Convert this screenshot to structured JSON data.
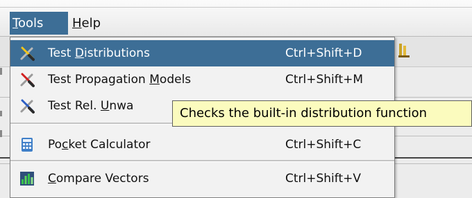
{
  "menubar": {
    "menus": [
      {
        "label": "Tools",
        "mnemonic": "T",
        "rest": "ools"
      },
      {
        "label": "Help",
        "mnemonic": "H",
        "rest": "elp"
      }
    ]
  },
  "tools_menu": {
    "items": [
      {
        "pre": "Test ",
        "mnemonic": "D",
        "post": "istributions",
        "accelerator": "Ctrl+Shift+D",
        "icon": "wrench-screwdriver-icon"
      },
      {
        "pre": "Test Propagation ",
        "mnemonic": "M",
        "post": "odels",
        "accelerator": "Ctrl+Shift+M",
        "icon": "wrench-screwdriver-icon"
      },
      {
        "pre": "Test Rel. ",
        "mnemonic": "U",
        "post": "nwa",
        "accelerator": "",
        "icon": "wrench-screwdriver-icon"
      },
      {
        "pre": "Po",
        "mnemonic": "c",
        "post": "ket Calculator",
        "accelerator": "Ctrl+Shift+C",
        "icon": "calculator-icon"
      },
      {
        "pre": "",
        "mnemonic": "C",
        "post": "ompare Vectors",
        "accelerator": "Ctrl+Shift+V",
        "icon": "bar-chart-icon"
      }
    ]
  },
  "tooltip": {
    "text": "Checks the built-in distribution function"
  },
  "colors": {
    "selection": "#3d6e96",
    "tooltip_bg": "#fbfbbe",
    "menu_bg": "#f2f2f2"
  }
}
